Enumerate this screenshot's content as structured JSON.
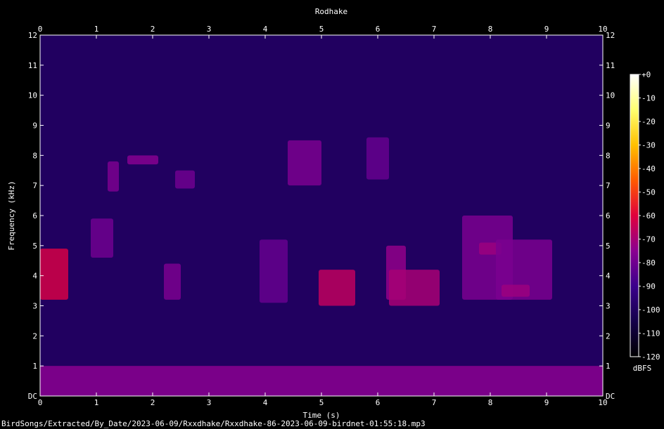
{
  "chart_data": {
    "type": "heatmap",
    "title": "Rodhake",
    "xlabel": "Time (s)",
    "ylabel": "Frequency (kHz)",
    "xlim": [
      0,
      10
    ],
    "ylim": [
      0,
      12
    ],
    "x_ticks": [
      "0",
      "1",
      "2",
      "3",
      "4",
      "5",
      "6",
      "7",
      "8",
      "9",
      "10"
    ],
    "y_ticks": [
      "DC",
      "1",
      "2",
      "3",
      "4",
      "5",
      "6",
      "7",
      "8",
      "9",
      "10",
      "11",
      "12"
    ],
    "colorbar": {
      "label": "dBFS",
      "range": [
        -120,
        0
      ],
      "ticks": [
        "+0",
        "-10",
        "-20",
        "-30",
        "-40",
        "-50",
        "-60",
        "-70",
        "-80",
        "-90",
        "-100",
        "-110",
        "-120"
      ],
      "colors": [
        "#000000",
        "#14004a",
        "#3a008c",
        "#8a0090",
        "#e0003c",
        "#ff5a00",
        "#ffc000",
        "#ffff70",
        "#ffffff"
      ]
    },
    "background_level_dbfs": -100,
    "low_frequency_band": {
      "t_start": 0,
      "t_end": 10,
      "f_start_khz": 0,
      "f_end_khz": 1,
      "level_dbfs": -75
    },
    "signal_regions": [
      {
        "t_start": 0.0,
        "t_end": 0.5,
        "f_start_khz": 3.2,
        "f_end_khz": 4.9,
        "level_dbfs": -62
      },
      {
        "t_start": 0.9,
        "t_end": 1.3,
        "f_start_khz": 4.6,
        "f_end_khz": 5.9,
        "level_dbfs": -80
      },
      {
        "t_start": 1.2,
        "t_end": 1.4,
        "f_start_khz": 6.8,
        "f_end_khz": 7.8,
        "level_dbfs": -78
      },
      {
        "t_start": 1.55,
        "t_end": 2.1,
        "f_start_khz": 7.7,
        "f_end_khz": 8.0,
        "level_dbfs": -76
      },
      {
        "t_start": 2.2,
        "t_end": 2.5,
        "f_start_khz": 3.2,
        "f_end_khz": 4.4,
        "level_dbfs": -78
      },
      {
        "t_start": 2.4,
        "t_end": 2.75,
        "f_start_khz": 6.9,
        "f_end_khz": 7.5,
        "level_dbfs": -80
      },
      {
        "t_start": 3.9,
        "t_end": 4.4,
        "f_start_khz": 3.1,
        "f_end_khz": 5.2,
        "level_dbfs": -82
      },
      {
        "t_start": 4.4,
        "t_end": 5.0,
        "f_start_khz": 7.0,
        "f_end_khz": 8.5,
        "level_dbfs": -78
      },
      {
        "t_start": 4.95,
        "t_end": 5.6,
        "f_start_khz": 3.0,
        "f_end_khz": 4.2,
        "level_dbfs": -66
      },
      {
        "t_start": 5.8,
        "t_end": 6.2,
        "f_start_khz": 7.2,
        "f_end_khz": 8.6,
        "level_dbfs": -82
      },
      {
        "t_start": 6.15,
        "t_end": 6.5,
        "f_start_khz": 3.2,
        "f_end_khz": 5.0,
        "level_dbfs": -74
      },
      {
        "t_start": 6.2,
        "t_end": 7.1,
        "f_start_khz": 3.0,
        "f_end_khz": 4.2,
        "level_dbfs": -70
      },
      {
        "t_start": 7.5,
        "t_end": 8.4,
        "f_start_khz": 3.2,
        "f_end_khz": 6.0,
        "level_dbfs": -78
      },
      {
        "t_start": 7.8,
        "t_end": 8.2,
        "f_start_khz": 4.7,
        "f_end_khz": 5.1,
        "level_dbfs": -72
      },
      {
        "t_start": 8.1,
        "t_end": 9.1,
        "f_start_khz": 3.2,
        "f_end_khz": 5.2,
        "level_dbfs": -78
      },
      {
        "t_start": 8.2,
        "t_end": 8.7,
        "f_start_khz": 3.3,
        "f_end_khz": 3.7,
        "level_dbfs": -72
      }
    ]
  },
  "footer": {
    "path": "BirdSongs/Extracted/By_Date/2023-06-09/Rxxdhake/Rxxdhake-86-2023-06-09-birdnet-01:55:18.mp3"
  }
}
